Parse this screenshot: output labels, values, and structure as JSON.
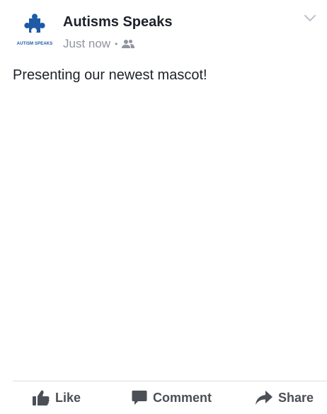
{
  "post": {
    "author": {
      "name": "Autisms Speaks",
      "avatar_caption": "AUTISM SPEAKS",
      "avatar_color": "#1f5aa6"
    },
    "meta": {
      "time": "Just now",
      "separator": "•",
      "audience_icon": "friends-icon"
    },
    "menu_icon": "chevron-down-icon",
    "text": "Presenting our newest mascot!"
  },
  "actions": {
    "like": {
      "label": "Like",
      "icon": "thumbs-up-icon"
    },
    "comment": {
      "label": "Comment",
      "icon": "comment-icon"
    },
    "share": {
      "label": "Share",
      "icon": "share-arrow-icon"
    }
  },
  "colors": {
    "text_primary": "#1d2129",
    "text_secondary": "#90949c",
    "action_text": "#4b4f56",
    "divider": "#dddfe2",
    "brand_blue": "#1f5aa6"
  }
}
